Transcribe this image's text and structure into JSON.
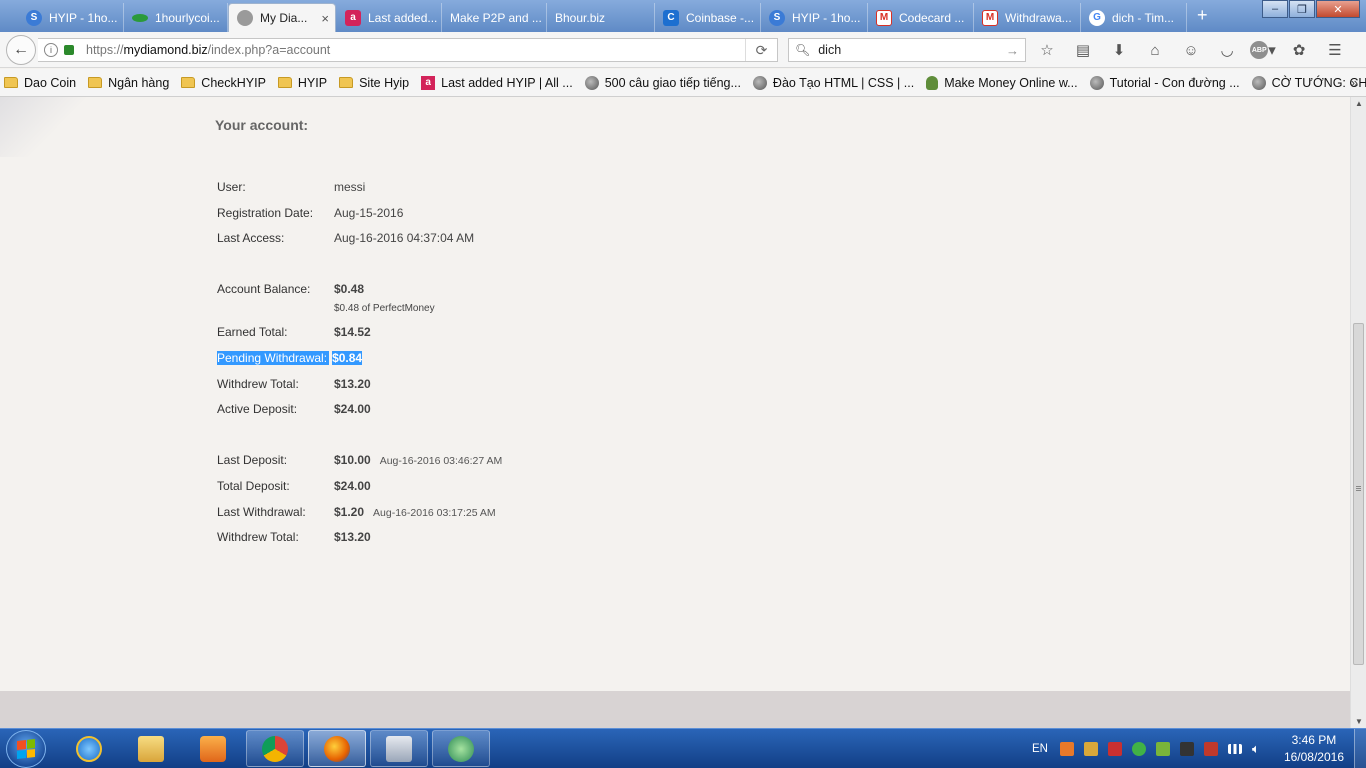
{
  "browser": {
    "tabs": [
      {
        "label": "HYIP - 1ho...",
        "favicon": "hyip-icon",
        "color": "#3b7bd6"
      },
      {
        "label": "1hourlycoi...",
        "favicon": "coin-icon",
        "color": "#2b9a3a"
      },
      {
        "label": "My Dia...",
        "favicon": "diamond-icon",
        "color": "#9a9a9a",
        "active": true
      },
      {
        "label": "Last added...",
        "favicon": "letter-a-icon",
        "color": "#d3235a"
      },
      {
        "label": "Make P2P and ...",
        "favicon": "",
        "color": ""
      },
      {
        "label": "Bhour.biz",
        "favicon": "",
        "color": ""
      },
      {
        "label": "Coinbase -...",
        "favicon": "coinbase-icon",
        "color": "#1d6fd0"
      },
      {
        "label": "HYIP - 1ho...",
        "favicon": "hyip-icon",
        "color": "#3b7bd6"
      },
      {
        "label": "Codecard ...",
        "favicon": "gmail-icon",
        "color": "#d93025"
      },
      {
        "label": "Withdrawa...",
        "favicon": "gmail-icon",
        "color": "#d93025"
      },
      {
        "label": "dich - Tim...",
        "favicon": "google-icon",
        "color": "#4285f4"
      }
    ],
    "new_tab_glyph": "+",
    "close_glyph": "×",
    "url": {
      "prefix": "https://",
      "domain": "mydiamond.biz",
      "path": "/index.php?a=account"
    },
    "search_value": "dich",
    "abp_label": "ABP"
  },
  "bookmarks": [
    {
      "label": "Dao Coin",
      "icon": "folder-icon"
    },
    {
      "label": "Ngân hàng",
      "icon": "folder-icon"
    },
    {
      "label": "CheckHYIP",
      "icon": "folder-icon"
    },
    {
      "label": "HYIP",
      "icon": "folder-icon"
    },
    {
      "label": "Site Hyip",
      "icon": "folder-icon"
    },
    {
      "label": "Last added HYIP | All ...",
      "icon": "letter-a-icon"
    },
    {
      "label": "500 câu giao tiếp tiếng...",
      "icon": "globe-icon"
    },
    {
      "label": "Đào Tạo HTML | CSS | ...",
      "icon": "globe-icon"
    },
    {
      "label": "Make Money Online w...",
      "icon": "android-icon"
    },
    {
      "label": "Tutorial - Con đường ...",
      "icon": "globe-icon"
    },
    {
      "label": "CỜ TƯỚNG: CHUYÊN ...",
      "icon": "globe-icon"
    }
  ],
  "account": {
    "title": "Your account:",
    "user_label": "User:",
    "user_value": "messi",
    "reg_label": "Registration Date:",
    "reg_value": "Aug-15-2016",
    "access_label": "Last Access:",
    "access_value": "Aug-16-2016 04:37:04 AM",
    "balance_label": "Account Balance:",
    "balance_value": "$0.48",
    "balance_sub": "$0.48 of PerfectMoney",
    "earned_label": "Earned Total:",
    "earned_value": "$14.52",
    "pending_label": "Pending Withdrawal:",
    "pending_value": "$0.84",
    "withdrew_label": "Withdrew Total:",
    "withdrew_value": "$13.20",
    "active_label": "Active Deposit:",
    "active_value": "$24.00",
    "last_dep_label": "Last Deposit:",
    "last_dep_value": "$10.00",
    "last_dep_date": "Aug-16-2016 03:46:27 AM",
    "total_dep_label": "Total Deposit:",
    "total_dep_value": "$24.00",
    "last_wd_label": "Last Withdrawal:",
    "last_wd_value": "$1.20",
    "last_wd_date": "Aug-16-2016 03:17:25 AM",
    "withdrew2_label": "Withdrew Total:",
    "withdrew2_value": "$13.20"
  },
  "taskbar": {
    "lang": "EN",
    "time": "3:46 PM",
    "date": "16/08/2016"
  }
}
